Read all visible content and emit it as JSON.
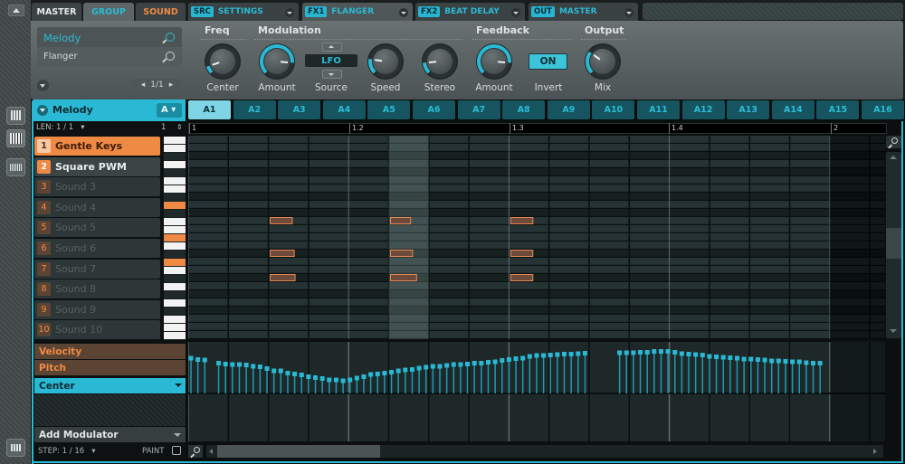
{
  "tabs": {
    "master": "MASTER",
    "group": "GROUP",
    "sound": "SOUND"
  },
  "slots": [
    {
      "tag": "SRC",
      "label": "SETTINGS"
    },
    {
      "tag": "FX1",
      "label": "FLANGER"
    },
    {
      "tag": "FX2",
      "label": "BEAT DELAY"
    },
    {
      "tag": "OUT",
      "label": "MASTER"
    }
  ],
  "preset": {
    "group_name": "Melody",
    "plugin_name": "Flanger",
    "page": "1/1"
  },
  "params": {
    "sections": [
      "Freq",
      "Modulation",
      "Feedback",
      "Output"
    ],
    "freq_center": {
      "label": "Center",
      "value": 0.1
    },
    "mod_amount": {
      "label": "Amount",
      "value": 0.85
    },
    "mod_source": {
      "label": "Source",
      "value": "LFO"
    },
    "mod_speed": {
      "label": "Speed",
      "value": 0.2
    },
    "mod_stereo": {
      "label": "Stereo",
      "value": 0.15
    },
    "fb_amount": {
      "label": "Amount",
      "value": 0.85
    },
    "fb_invert": {
      "label": "Invert",
      "value": "ON"
    },
    "out_mix": {
      "label": "Mix",
      "value": 0.3
    }
  },
  "group_header": {
    "name": "Melody",
    "bank": "A"
  },
  "len": "LEN: 1 / 1",
  "len_num": "1",
  "patterns": [
    "A1",
    "A2",
    "A3",
    "A4",
    "A5",
    "A6",
    "A7",
    "A8",
    "A9",
    "A10",
    "A11",
    "A12",
    "A13",
    "A14",
    "A15",
    "A16"
  ],
  "selected_pattern": "A1",
  "ruler": [
    "1",
    "1.2",
    "1.3",
    "1.4",
    "2"
  ],
  "sounds": [
    {
      "n": "1",
      "name": "Gentle Keys",
      "state": "selected"
    },
    {
      "n": "2",
      "name": "Square PWM",
      "state": "active"
    },
    {
      "n": "3",
      "name": "Sound 3",
      "state": "empty"
    },
    {
      "n": "4",
      "name": "Sound 4",
      "state": "empty"
    },
    {
      "n": "5",
      "name": "Sound 5",
      "state": "empty"
    },
    {
      "n": "6",
      "name": "Sound 6",
      "state": "empty"
    },
    {
      "n": "7",
      "name": "Sound 7",
      "state": "empty"
    },
    {
      "n": "8",
      "name": "Sound 8",
      "state": "empty"
    },
    {
      "n": "9",
      "name": "Sound 9",
      "state": "empty"
    },
    {
      "n": "10",
      "name": "Sound 10",
      "state": "empty"
    }
  ],
  "notes": [
    {
      "row": 1,
      "step": 3,
      "len": 0.55
    },
    {
      "row": 1,
      "step": 7,
      "len": 0.5
    },
    {
      "row": 1,
      "step": 10,
      "len": 0.55
    },
    {
      "row": 2,
      "step": 3,
      "len": 0.6
    },
    {
      "row": 2,
      "step": 7,
      "len": 0.55
    },
    {
      "row": 2,
      "step": 10,
      "len": 0.55
    },
    {
      "row": 3,
      "step": 3,
      "len": 0.62
    },
    {
      "row": 3,
      "step": 7,
      "len": 0.65
    },
    {
      "row": 3,
      "step": 10,
      "len": 0.55
    }
  ],
  "modulation": {
    "lanes": [
      "Velocity",
      "Pitch"
    ],
    "selected": "Center",
    "add": "Add Modulator",
    "step": "STEP: 1 / 16",
    "paint": "PAINT",
    "values": [
      0.78,
      0.75,
      0.74,
      0.67,
      0.65,
      0.64,
      0.64,
      0.63,
      0.6,
      0.59,
      0.55,
      0.5,
      0.5,
      0.45,
      0.43,
      0.41,
      0.37,
      0.35,
      0.33,
      0.3,
      0.3,
      0.28,
      0.3,
      0.34,
      0.37,
      0.42,
      0.43,
      0.45,
      0.47,
      0.5,
      0.52,
      0.53,
      0.56,
      0.58,
      0.6,
      0.6,
      0.62,
      0.64,
      0.64,
      0.65,
      0.67,
      0.67,
      0.69,
      0.7,
      0.73,
      0.75,
      0.77,
      0.78,
      0.82,
      0.84,
      0.84,
      0.85,
      0.86,
      0.87,
      0.87,
      0.88,
      0.89,
      0.9,
      0.9,
      0.9,
      0.91,
      0.91,
      0.93,
      0.93,
      0.93,
      0.91,
      0.88,
      0.87,
      0.86,
      0.85,
      0.82,
      0.81,
      0.8,
      0.79,
      0.78,
      0.76,
      0.76,
      0.75,
      0.74,
      0.72,
      0.72,
      0.71,
      0.7,
      0.7,
      0.68,
      0.67,
      0.67
    ],
    "gaps": [
      3,
      58,
      59,
      60,
      61
    ]
  }
}
